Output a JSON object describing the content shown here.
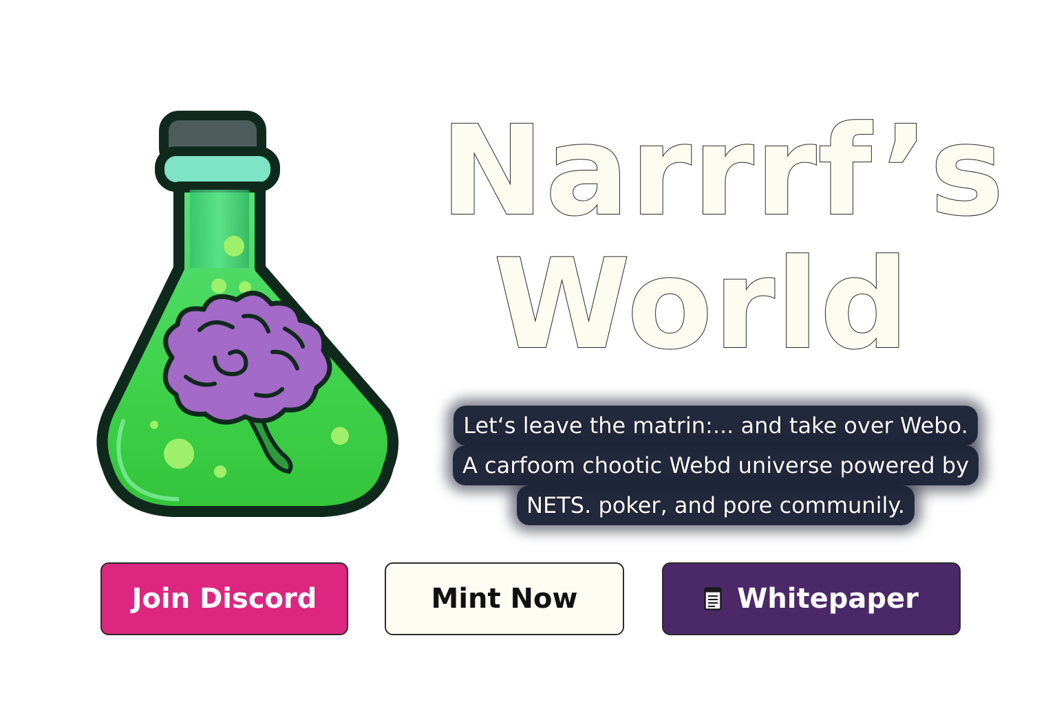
{
  "title": {
    "line1": "Narrrf’s",
    "line2": "World"
  },
  "tagline": {
    "line1": "Let‘s leave the matrin:... and take over Webo.",
    "line2": "A carfoom chootic Webd universe powered by",
    "line3": "NETS. poker, and pore communily."
  },
  "buttons": {
    "discord": "Join Discord",
    "mint": "Mint Now",
    "whitepaper": "Whitepaper"
  },
  "icons": {
    "flask": "flask-brain-illustration",
    "whitepaper": "document-icon"
  },
  "colors": {
    "discord": "#dc2680",
    "mint": "#fdfdf3",
    "whitepaper": "#4b2868",
    "flask_liquid": "#3fd24a",
    "brain": "#a46ac7"
  }
}
